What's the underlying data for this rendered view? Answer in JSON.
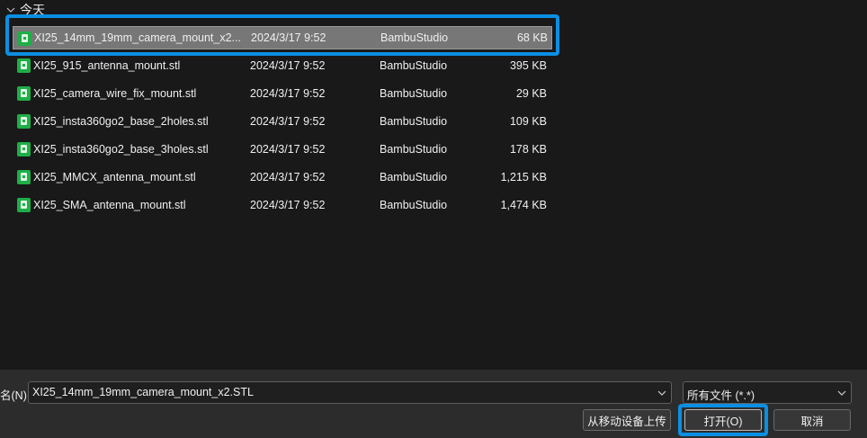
{
  "group": {
    "label": "今天"
  },
  "files": [
    {
      "name": "XI25_14mm_19mm_camera_mount_x2...",
      "date": "2024/3/17 9:52",
      "type": "BambuStudio",
      "size": "68 KB",
      "selected": true
    },
    {
      "name": "XI25_915_antenna_mount.stl",
      "date": "2024/3/17 9:52",
      "type": "BambuStudio",
      "size": "395 KB"
    },
    {
      "name": "XI25_camera_wire_fix_mount.stl",
      "date": "2024/3/17 9:52",
      "type": "BambuStudio",
      "size": "29 KB"
    },
    {
      "name": "XI25_insta360go2_base_2holes.stl",
      "date": "2024/3/17 9:52",
      "type": "BambuStudio",
      "size": "109 KB"
    },
    {
      "name": "XI25_insta360go2_base_3holes.stl",
      "date": "2024/3/17 9:52",
      "type": "BambuStudio",
      "size": "178 KB"
    },
    {
      "name": "XI25_MMCX_antenna_mount.stl",
      "date": "2024/3/17 9:52",
      "type": "BambuStudio",
      "size": "1,215 KB"
    },
    {
      "name": "XI25_SMA_antenna_mount.stl",
      "date": "2024/3/17 9:52",
      "type": "BambuStudio",
      "size": "1,474 KB"
    }
  ],
  "bottom": {
    "filename_label": "名(N):",
    "filename_value": "XI25_14mm_19mm_camera_mount_x2.STL",
    "filetype_value": "所有文件 (*.*)",
    "upload_label": "从移动设备上传",
    "open_label": "打开(O)",
    "cancel_label": "取消"
  },
  "colors": {
    "background": "#191919",
    "selection": "#777777",
    "accent": "#0b8fe3",
    "file_icon": "#1fae48",
    "bottom_bar": "#2c2c2c"
  },
  "icons": {
    "group_toggle": "chevron-down-icon",
    "file": "bambu-stl-file-icon",
    "combo": "chevron-down-icon"
  }
}
